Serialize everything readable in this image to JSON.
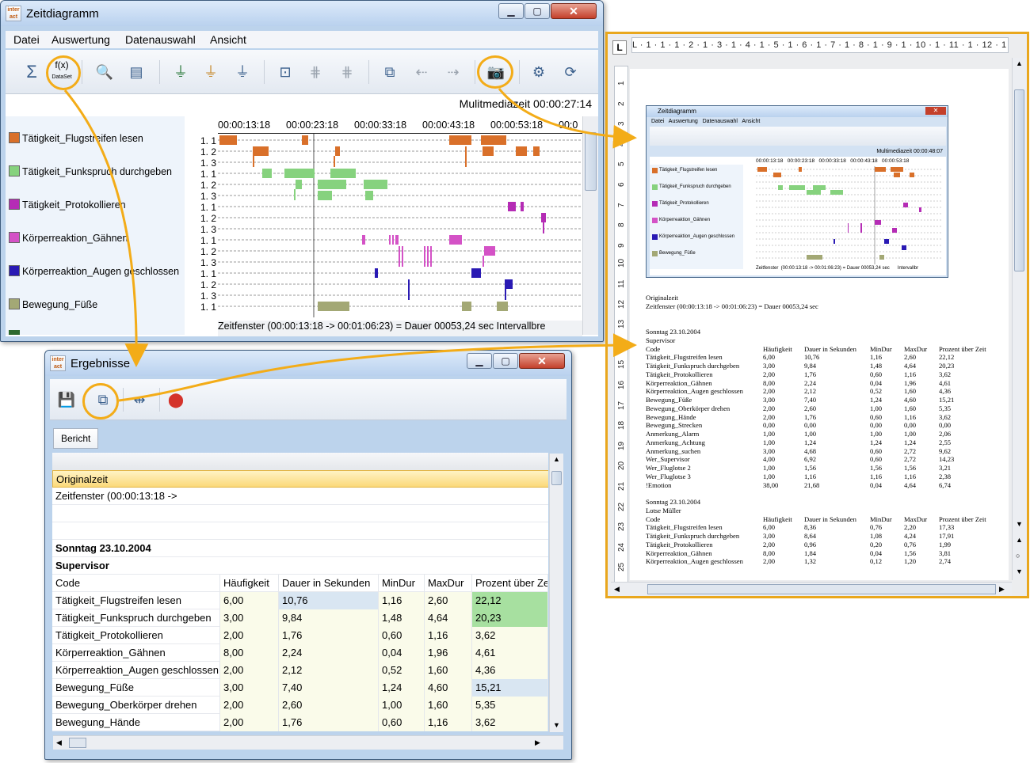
{
  "colors": {
    "orange": "#d9702a",
    "green": "#86d27e",
    "magenta": "#b52cb5",
    "pink": "#d452c6",
    "navy": "#2a1ab4",
    "olive": "#a3a875",
    "highlight": "#f3ac18",
    "cell_blue": "#d9e6f2",
    "cell_green": "#a7e0a0",
    "cell_cream": "#fafbea"
  },
  "zeitdiagramm": {
    "title": "Zeitdiagramm",
    "menu": [
      "Datei",
      "Auswertung",
      "Datenauswahl",
      "Ansicht"
    ],
    "toolbar_fx": "f(x)",
    "toolbar_fx_sub": "DataSet",
    "multimedia_time": "Mulitmediazeit 00:00:27:14",
    "time_ticks": [
      "00:00:13:18",
      "00:00:23:18",
      "00:00:33:18",
      "00:00:43:18",
      "00:00:53:18",
      "00:0"
    ],
    "codes": [
      {
        "name": "Tätigkeit_Flugstreifen lesen",
        "color": "#d9702a"
      },
      {
        "name": "Tätigkeit_Funkspruch durchgeben",
        "color": "#86d27e"
      },
      {
        "name": "Tätigkeit_Protokollieren",
        "color": "#b52cb5"
      },
      {
        "name": "Körperreaktion_Gähnen",
        "color": "#d452c6"
      },
      {
        "name": "Körperreaktion_Augen geschlossen",
        "color": "#2a1ab4"
      },
      {
        "name": "Bewegung_Füße",
        "color": "#a3a875"
      }
    ],
    "row_labels": [
      "1. 1",
      "1. 2",
      "1. 3",
      "1. 1",
      "1. 2",
      "1. 3",
      "1. 1",
      "1. 2",
      "1. 3",
      "1. 1",
      "1. 2",
      "1. 3",
      "1. 1",
      "1. 2",
      "1. 3",
      "1. 1"
    ],
    "status": "Zeitfenster   (00:00:13:18 -> 00:01:06:23) = Dauer 00053,24 sec      Intervallbre"
  },
  "ergebnisse": {
    "title": "Ergebnisse",
    "tab": "Bericht",
    "rows": [
      {
        "c": [
          "Originalzeit"
        ],
        "style": "selected"
      },
      {
        "c": [
          "Zeitfenster  (00:00:13:18 ->"
        ]
      },
      {
        "c": [
          ""
        ]
      },
      {
        "c": [
          ""
        ]
      },
      {
        "c": [
          "Sonntag 23.10.2004"
        ],
        "style": "bold"
      },
      {
        "c": [
          "Supervisor"
        ],
        "style": "bold"
      },
      {
        "c": [
          "Code",
          "Häufigkeit",
          "Dauer in Sekunden",
          "MinDur",
          "MaxDur",
          "Prozent über Ze"
        ]
      },
      {
        "c": [
          "Tätigkeit_Flugstreifen lesen",
          "6,00",
          "10,76",
          "1,16",
          "2,60",
          "22,12"
        ],
        "hl": {
          "2": "blue",
          "5": "green"
        }
      },
      {
        "c": [
          "Tätigkeit_Funkspruch durchgeben",
          "3,00",
          "9,84",
          "1,48",
          "4,64",
          "20,23"
        ],
        "hl": {
          "5": "green"
        }
      },
      {
        "c": [
          "Tätigkeit_Protokollieren",
          "2,00",
          "1,76",
          "0,60",
          "1,16",
          "3,62"
        ]
      },
      {
        "c": [
          "Körperreaktion_Gähnen",
          "8,00",
          "2,24",
          "0,04",
          "1,96",
          "4,61"
        ]
      },
      {
        "c": [
          "Körperreaktion_Augen geschlossen",
          "2,00",
          "2,12",
          "0,52",
          "1,60",
          "4,36"
        ]
      },
      {
        "c": [
          "Bewegung_Füße",
          "3,00",
          "7,40",
          "1,24",
          "4,60",
          "15,21"
        ],
        "hl": {
          "5": "blue"
        }
      },
      {
        "c": [
          "Bewegung_Oberkörper drehen",
          "2,00",
          "2,60",
          "1,00",
          "1,60",
          "5,35"
        ]
      },
      {
        "c": [
          "Bewegung_Hände",
          "2,00",
          "1,76",
          "0,60",
          "1,16",
          "3,62"
        ]
      }
    ]
  },
  "document": {
    "ruler_h": "L · 1 · 1 · 1 · 2 · 1 · 3 · 1 · 4 · 1 · 5 · 1 · 6 · 1 · 7 · 1 · 8 · 1 · 9 · 1 · 10 · 1 · 11 · 1 · 12 · 1 · 13 · 1 · 14 · 1 · 15 · 1 · 16 · 1 · 17 · 1 · 18 · 1 ·",
    "ruler_v": [
      "1",
      "2",
      "3",
      "4",
      "5",
      "6",
      "7",
      "8",
      "9",
      "10",
      "11",
      "12",
      "13",
      "14",
      "15",
      "16",
      "17",
      "18",
      "19",
      "20",
      "21",
      "22",
      "23",
      "24",
      "25"
    ],
    "thumb_title": "Zeitdiagramm",
    "thumb_menu": "Datei   Auswertung   Datenauswahl   Ansicht",
    "thumb_mm": "Multimediazeit 00:00:48:07",
    "thumb_ticks": "00:00:13:18   00:00:23:18   00:00:33:18   00:00:43:18   00:00:53:18",
    "thumb_status": "Zeitfenster  (00:00:13:18 -> 00:01:06:23) = Dauer 00053,24 sec      Intervallbr",
    "thumb_codes": [
      "Tätigkeit_Flugstreifen lesen",
      "Tätigkeit_Funkspruch durchgeben",
      "Tätigkeit_Protokollieren",
      "Körperreaktion_Gähnen",
      "Körperreaktion_Augen geschlossen",
      "Bewegung_Füße"
    ],
    "intro": [
      "Originalzeit",
      "Zeitfenster  (00:00:13:18 -> 00:01:06:23)  = Dauer 00053,24 sec"
    ],
    "section1_date": "Sonntag 23.10.2004",
    "section1_person": "Supervisor",
    "headers": [
      "Code",
      "Häufigkeit",
      "Dauer in Sekunden",
      "MinDur",
      "MaxDur",
      "Prozent über Zeit"
    ],
    "section1_rows": [
      [
        "Tätigkeit_Flugstreifen  lesen",
        "6,00",
        "10,76",
        "1,16",
        "2,60",
        "22,12"
      ],
      [
        "Tätigkeit_Funkspruch durchgeben",
        "3,00",
        "9,84",
        "1,48",
        "4,64",
        "20,23"
      ],
      [
        "Tätigkeit_Protokollieren",
        "2,00",
        "1,76",
        "0,60",
        "1,16",
        "3,62"
      ],
      [
        "Körperreaktion_Gähnen",
        "8,00",
        "2,24",
        "0,04",
        "1,96",
        "4,61"
      ],
      [
        "Körperreaktion_Augen geschlossen",
        "2,00",
        "2,12",
        "0,52",
        "1,60",
        "4,36"
      ],
      [
        "Bewegung_Füße",
        "3,00",
        "7,40",
        "1,24",
        "4,60",
        "15,21"
      ],
      [
        "Bewegung_Oberkörper  drehen",
        "2,00",
        "2,60",
        "1,00",
        "1,60",
        "5,35"
      ],
      [
        "Bewegung_Hände",
        "2,00",
        "1,76",
        "0,60",
        "1,16",
        "3,62"
      ],
      [
        "Bewegung_Strecken",
        "0,00",
        "0,00",
        "0,00",
        "0,00",
        "0,00"
      ],
      [
        "Anmerkung_Alarm",
        "1,00",
        "1,00",
        "1,00",
        "1,00",
        "2,06"
      ],
      [
        "Anmerkung_Achtung",
        "1,00",
        "1,24",
        "1,24",
        "1,24",
        "2,55"
      ],
      [
        "Anmerkung_suchen",
        "3,00",
        "4,68",
        "0,60",
        "2,72",
        "9,62"
      ],
      [
        "Wer_Supervisor",
        "4,00",
        "6,92",
        "0,60",
        "2,72",
        "14,23"
      ],
      [
        "Wer_Fluglotse  2",
        "1,00",
        "1,56",
        "1,56",
        "1,56",
        "3,21"
      ],
      [
        "Wer_Fluglotse  3",
        "1,00",
        "1,16",
        "1,16",
        "1,16",
        "2,38"
      ],
      [
        "!Emotion",
        "38,00",
        "21,68",
        "0,04",
        "4,64",
        "6,74"
      ]
    ],
    "section2_date": "Sonntag 23.10.2004",
    "section2_person": "Lotse Müller",
    "section2_rows": [
      [
        "Tätigkeit_Flugstreifen  lesen",
        "6,00",
        "8,36",
        "0,76",
        "2,20",
        "17,33"
      ],
      [
        "Tätigkeit_Funkspruch durchgeben",
        "3,00",
        "8,64",
        "1,08",
        "4,24",
        "17,91"
      ],
      [
        "Tätigkeit_Protokollieren",
        "2,00",
        "0,96",
        "0,20",
        "0,76",
        "1,99"
      ],
      [
        "Körperreaktion_Gähnen",
        "8,00",
        "1,84",
        "0,04",
        "1,56",
        "3,81"
      ],
      [
        "Körperreaktion_Augen geschlossen",
        "2,00",
        "1,32",
        "0,12",
        "1,20",
        "2,74"
      ]
    ]
  }
}
